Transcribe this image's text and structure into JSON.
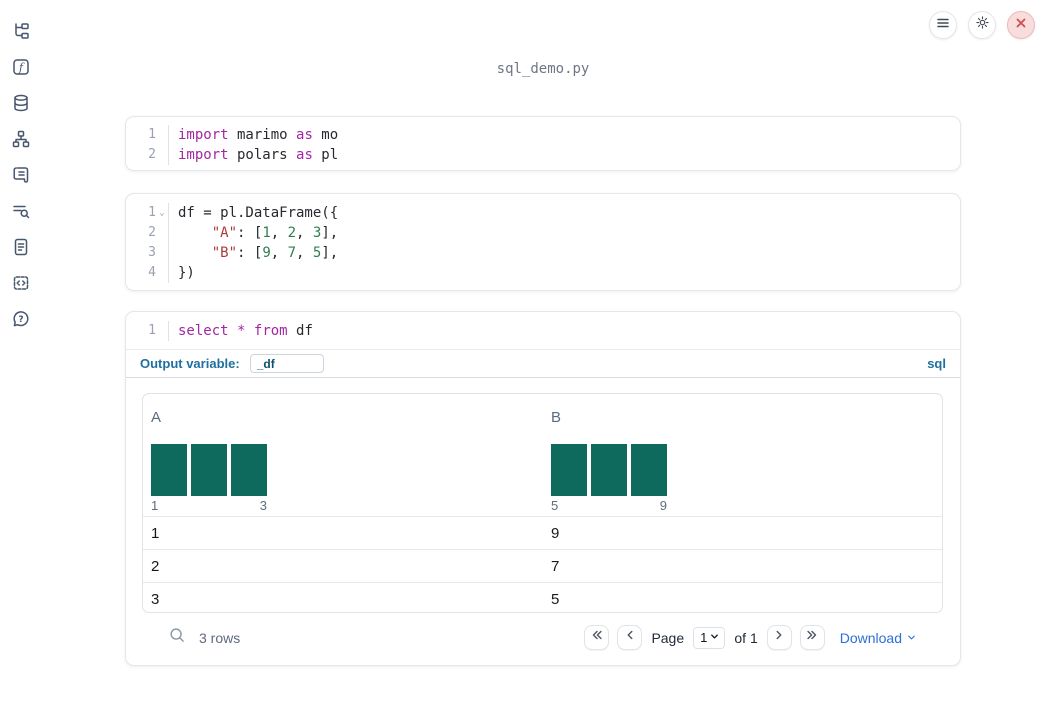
{
  "app": {
    "title": "sql_demo.py"
  },
  "colors": {
    "bar": "#0e6a5c",
    "accent_blue": "#1f6f9f",
    "link_blue": "#2d6fd6",
    "keyword": "#a327a0",
    "string": "#a93c38",
    "number": "#2f7d4f"
  },
  "sidebar": {
    "items": [
      {
        "icon": "file-explorer-icon"
      },
      {
        "icon": "functions-icon"
      },
      {
        "icon": "datasources-icon"
      },
      {
        "icon": "dependency-graph-icon"
      },
      {
        "icon": "scratchpad-icon"
      },
      {
        "icon": "logs-icon"
      },
      {
        "icon": "documentation-icon"
      },
      {
        "icon": "snippets-icon"
      },
      {
        "icon": "help-icon"
      }
    ]
  },
  "topbar": {
    "buttons": [
      {
        "icon": "menu-icon"
      },
      {
        "icon": "settings-icon"
      },
      {
        "icon": "close-icon"
      }
    ]
  },
  "cells": [
    {
      "lines": [
        {
          "num": "1",
          "fold": false,
          "tokens": [
            {
              "t": "import",
              "c": "kw"
            },
            {
              "t": " marimo ",
              "c": "tx"
            },
            {
              "t": "as",
              "c": "kw"
            },
            {
              "t": " mo",
              "c": "tx"
            }
          ]
        },
        {
          "num": "2",
          "fold": false,
          "tokens": [
            {
              "t": "import",
              "c": "kw"
            },
            {
              "t": " polars ",
              "c": "tx"
            },
            {
              "t": "as",
              "c": "kw"
            },
            {
              "t": " pl",
              "c": "tx"
            }
          ]
        }
      ]
    },
    {
      "lines": [
        {
          "num": "1",
          "fold": true,
          "tokens": [
            {
              "t": "df = pl.DataFrame({",
              "c": "tx"
            }
          ]
        },
        {
          "num": "2",
          "fold": false,
          "tokens": [
            {
              "t": "    ",
              "c": "tx"
            },
            {
              "t": "\"A\"",
              "c": "str"
            },
            {
              "t": ": [",
              "c": "tx"
            },
            {
              "t": "1",
              "c": "num"
            },
            {
              "t": ", ",
              "c": "tx"
            },
            {
              "t": "2",
              "c": "num"
            },
            {
              "t": ", ",
              "c": "tx"
            },
            {
              "t": "3",
              "c": "num"
            },
            {
              "t": "],",
              "c": "tx"
            }
          ]
        },
        {
          "num": "3",
          "fold": false,
          "tokens": [
            {
              "t": "    ",
              "c": "tx"
            },
            {
              "t": "\"B\"",
              "c": "str"
            },
            {
              "t": ": [",
              "c": "tx"
            },
            {
              "t": "9",
              "c": "num"
            },
            {
              "t": ", ",
              "c": "tx"
            },
            {
              "t": "7",
              "c": "num"
            },
            {
              "t": ", ",
              "c": "tx"
            },
            {
              "t": "5",
              "c": "num"
            },
            {
              "t": "],",
              "c": "tx"
            }
          ]
        },
        {
          "num": "4",
          "fold": false,
          "tokens": [
            {
              "t": "})",
              "c": "tx"
            }
          ]
        }
      ]
    },
    {
      "lines": [
        {
          "num": "1",
          "fold": false,
          "tokens": [
            {
              "t": "select",
              "c": "kw"
            },
            {
              "t": " ",
              "c": "tx"
            },
            {
              "t": "*",
              "c": "kw"
            },
            {
              "t": " ",
              "c": "tx"
            },
            {
              "t": "from",
              "c": "kw"
            },
            {
              "t": " df",
              "c": "tx"
            }
          ]
        }
      ]
    }
  ],
  "sql_meta": {
    "output_variable_label": "Output variable:",
    "output_variable_value": "_df",
    "language_badge": "sql"
  },
  "table": {
    "columns": [
      {
        "label": "A",
        "hist": {
          "type": "bar",
          "values": [
            1,
            1,
            1
          ],
          "min_label": "1",
          "max_label": "3"
        }
      },
      {
        "label": "B",
        "hist": {
          "type": "bar",
          "values": [
            1,
            1,
            1
          ],
          "min_label": "5",
          "max_label": "9"
        }
      }
    ],
    "rows": [
      [
        "1",
        "9"
      ],
      [
        "2",
        "7"
      ],
      [
        "3",
        "5"
      ]
    ],
    "footer": {
      "row_count": "3 rows",
      "page_label": "Page",
      "page_value": "1",
      "of_label": "of 1",
      "download_label": "Download"
    }
  }
}
